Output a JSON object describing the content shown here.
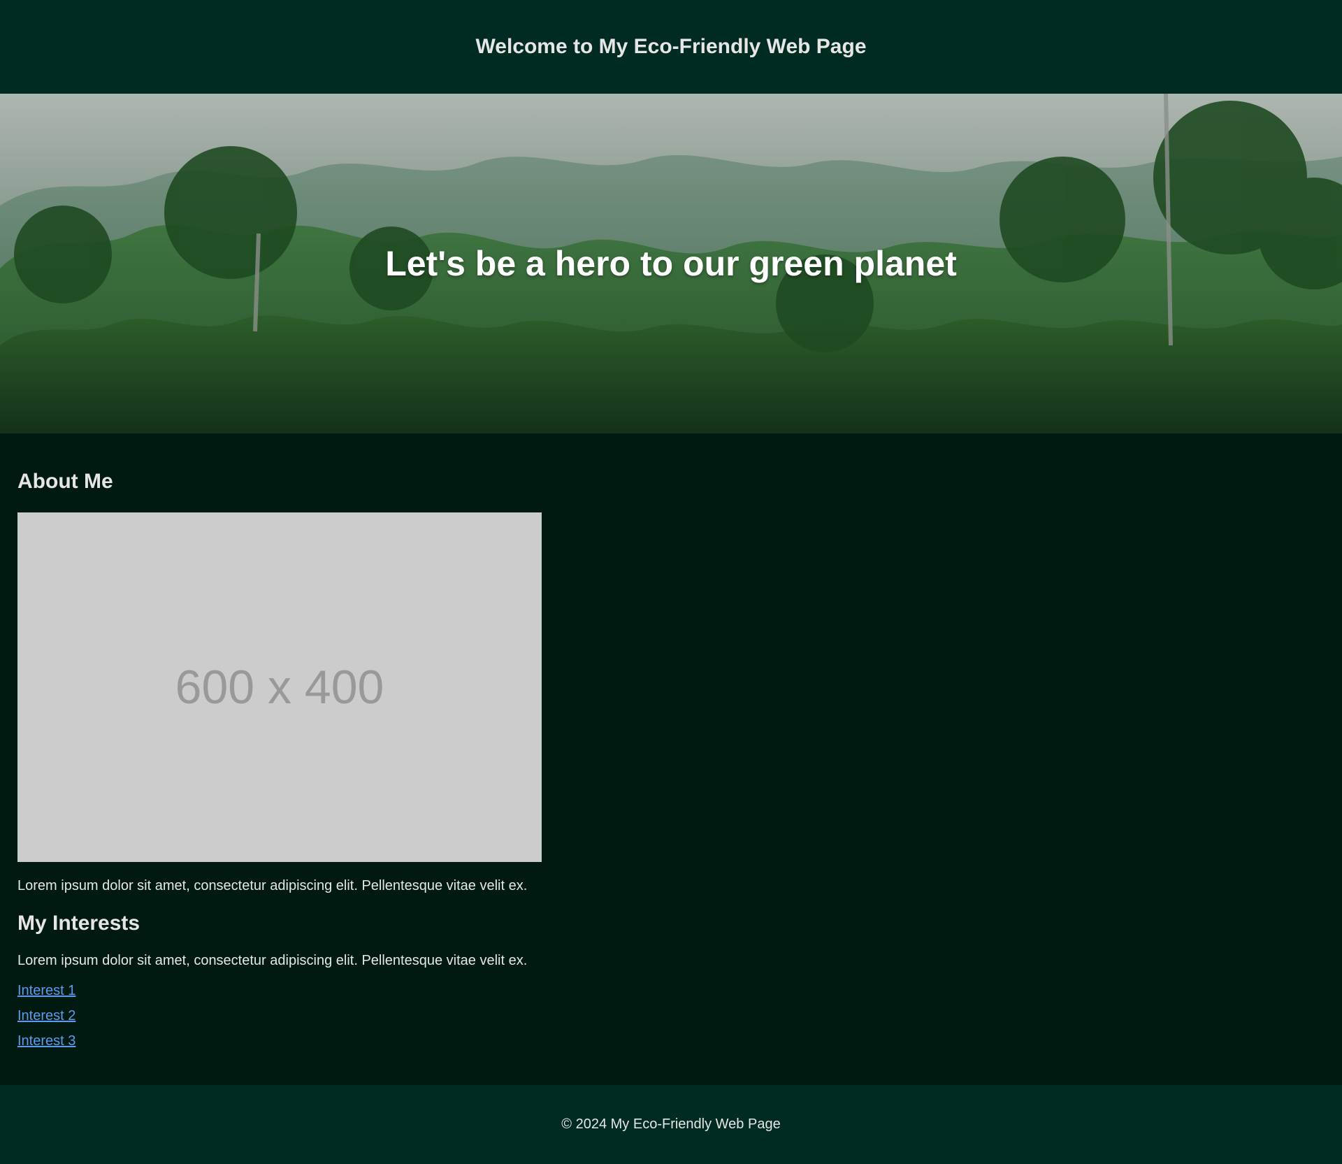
{
  "header": {
    "title": "Welcome to My Eco-Friendly Web Page"
  },
  "hero": {
    "title": "Let's be a hero to our green planet"
  },
  "about": {
    "heading": "About Me",
    "image_placeholder": "600 x 400",
    "text": "Lorem ipsum dolor sit amet, consectetur adipiscing elit. Pellentesque vitae velit ex."
  },
  "interests": {
    "heading": "My Interests",
    "text": "Lorem ipsum dolor sit amet, consectetur adipiscing elit. Pellentesque vitae velit ex.",
    "links": [
      "Interest 1",
      "Interest 2",
      "Interest 3"
    ]
  },
  "footer": {
    "text": "© 2024 My Eco-Friendly Web Page"
  },
  "colors": {
    "header_bg": "#002b22",
    "page_bg": "#001a12",
    "link": "#5b9bf0",
    "placeholder_bg": "#cccccc"
  }
}
